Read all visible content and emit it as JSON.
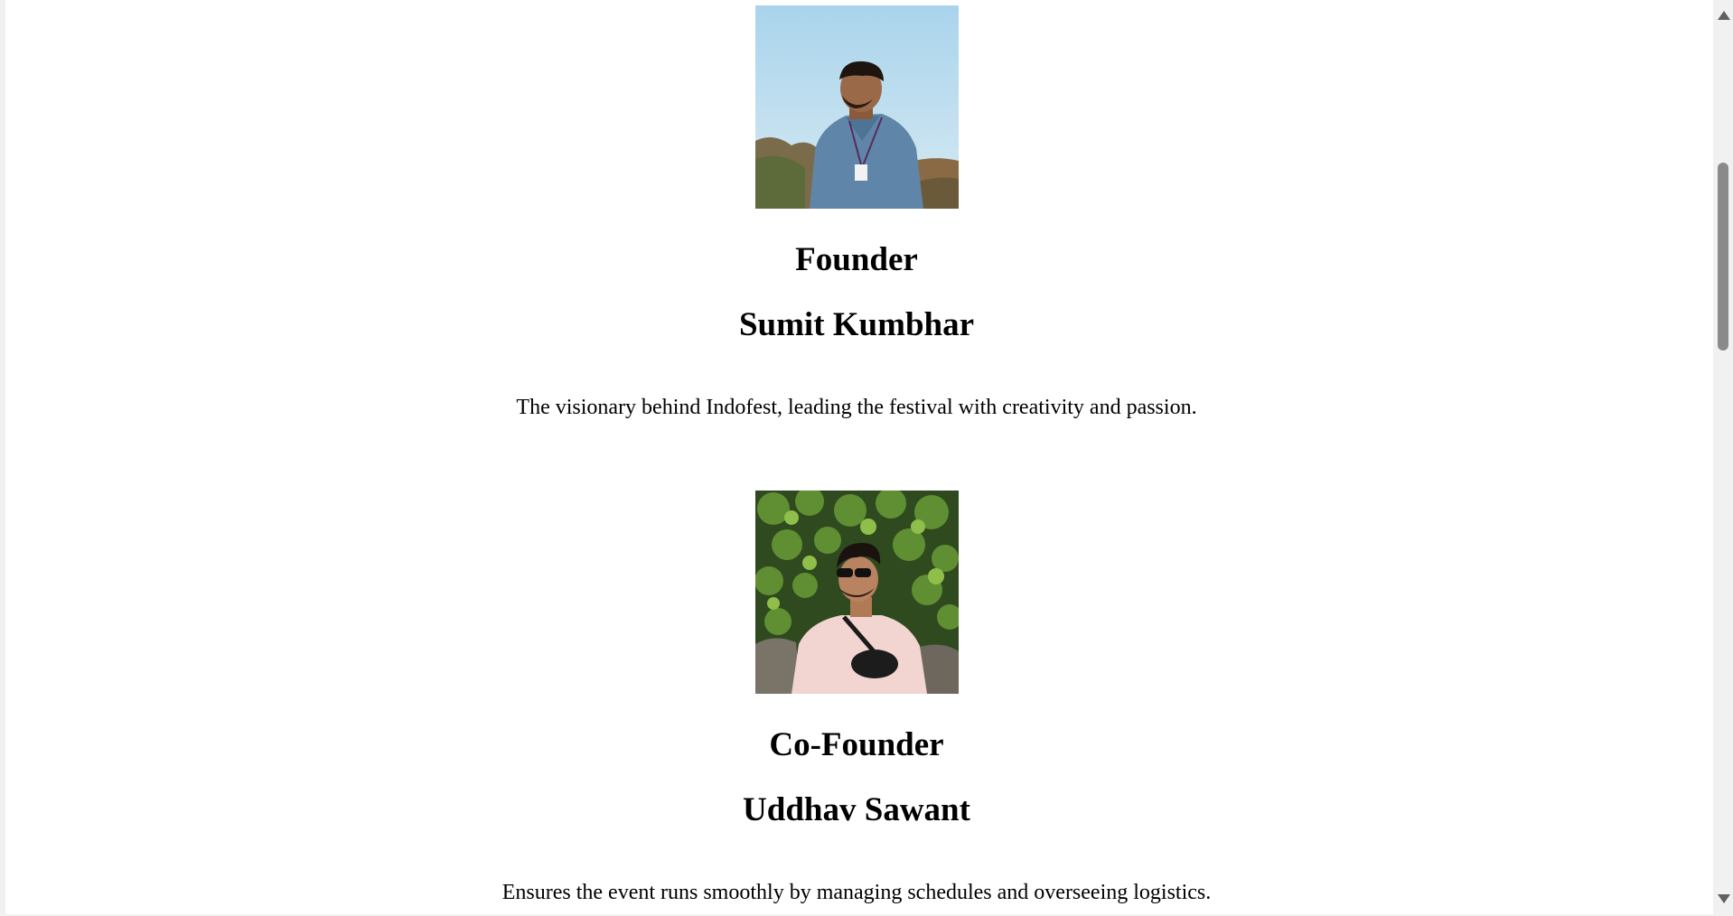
{
  "members": [
    {
      "role": "Founder",
      "name": "Sumit Kumbhar",
      "description": "The visionary behind Indofest, leading the festival with creativity and passion.",
      "photo_icon": "founder-photo"
    },
    {
      "role": "Co-Founder",
      "name": "Uddhav Sawant",
      "description": "Ensures the event runs smoothly by managing schedules and overseeing logistics.",
      "photo_icon": "co-founder-photo"
    }
  ],
  "colors": {
    "page_background": "#ffffff",
    "text": "#000000",
    "scrollbar_track": "#f1f1f1",
    "scrollbar_thumb": "#8a8a8a"
  }
}
